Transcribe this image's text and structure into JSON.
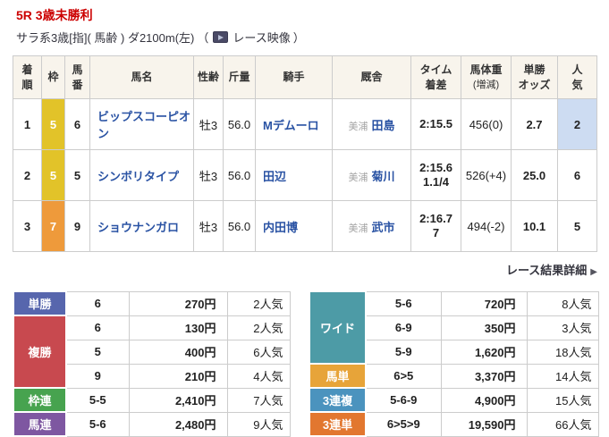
{
  "race": {
    "title": "5R 3歳未勝利",
    "conditions": "サラ系3歳[指]( 馬齢 ) ダ2100m(左)",
    "paren_open": "（",
    "paren_close": "）",
    "video_label": "レース映像"
  },
  "results": {
    "headers": {
      "rank": "着\n順",
      "waku": "枠",
      "number": "馬\n番",
      "name": "馬名",
      "sex_age": "性齢",
      "weight": "斤量",
      "jockey": "騎手",
      "stable": "厩舎",
      "time": "タイム\n着差",
      "horse_weight": "馬体重",
      "horse_weight_sub": "(増減)",
      "odds": "単勝\nオッズ",
      "ninki": "人\n気"
    },
    "rows": [
      {
        "rank": "1",
        "waku": "5",
        "waku_color": "#e2c329",
        "number": "6",
        "name": "ビップスコーピオン",
        "sex_age": "牡3",
        "weight": "56.0",
        "jockey": "Mデムーロ",
        "stable_area": "美浦",
        "trainer": "田島",
        "time": "2:15.5",
        "margin": "",
        "horse_weight": "456(0)",
        "odds": "2.7",
        "ninki": "2",
        "ninki_bg": "#cddcf2"
      },
      {
        "rank": "2",
        "waku": "5",
        "waku_color": "#e2c329",
        "number": "5",
        "name": "シンボリタイプ",
        "sex_age": "牡3",
        "weight": "56.0",
        "jockey": "田辺",
        "stable_area": "美浦",
        "trainer": "菊川",
        "time": "2:15.6",
        "margin": "1.1/4",
        "horse_weight": "526(+4)",
        "odds": "25.0",
        "ninki": "6",
        "ninki_bg": ""
      },
      {
        "rank": "3",
        "waku": "7",
        "waku_color": "#ee9a3b",
        "number": "9",
        "name": "ショウナンガロ",
        "sex_age": "牡3",
        "weight": "56.0",
        "jockey": "内田博",
        "stable_area": "美浦",
        "trainer": "武市",
        "time": "2:16.7",
        "margin": "7",
        "horse_weight": "494(-2)",
        "odds": "10.1",
        "ninki": "5",
        "ninki_bg": ""
      }
    ]
  },
  "detail_link": {
    "label": "レース結果詳細",
    "arrow": "▶"
  },
  "payouts": {
    "left": [
      {
        "type": "単勝",
        "color": "#5766ad",
        "rows": [
          {
            "combo": "6",
            "payout": "270円",
            "ninki": "2人気"
          }
        ]
      },
      {
        "type": "複勝",
        "color": "#c8494f",
        "rows": [
          {
            "combo": "6",
            "payout": "130円",
            "ninki": "2人気"
          },
          {
            "combo": "5",
            "payout": "400円",
            "ninki": "6人気"
          },
          {
            "combo": "9",
            "payout": "210円",
            "ninki": "4人気"
          }
        ]
      },
      {
        "type": "枠連",
        "color": "#47a34f",
        "rows": [
          {
            "combo": "5-5",
            "payout": "2,410円",
            "ninki": "7人気"
          }
        ]
      },
      {
        "type": "馬連",
        "color": "#7e57a1",
        "rows": [
          {
            "combo": "5-6",
            "payout": "2,480円",
            "ninki": "9人気"
          }
        ]
      }
    ],
    "right": [
      {
        "type": "ワイド",
        "color": "#4d9ba6",
        "rows": [
          {
            "combo": "5-6",
            "payout": "720円",
            "ninki": "8人気"
          },
          {
            "combo": "6-9",
            "payout": "350円",
            "ninki": "3人気"
          },
          {
            "combo": "5-9",
            "payout": "1,620円",
            "ninki": "18人気"
          }
        ]
      },
      {
        "type": "馬単",
        "color": "#e7a439",
        "rows": [
          {
            "combo": "6>5",
            "payout": "3,370円",
            "ninki": "14人気"
          }
        ]
      },
      {
        "type": "3連複",
        "color": "#4b93be",
        "rows": [
          {
            "combo": "5-6-9",
            "payout": "4,900円",
            "ninki": "15人気"
          }
        ]
      },
      {
        "type": "3連単",
        "color": "#e2772f",
        "rows": [
          {
            "combo": "6>5>9",
            "payout": "19,590円",
            "ninki": "66人気"
          }
        ]
      }
    ]
  }
}
